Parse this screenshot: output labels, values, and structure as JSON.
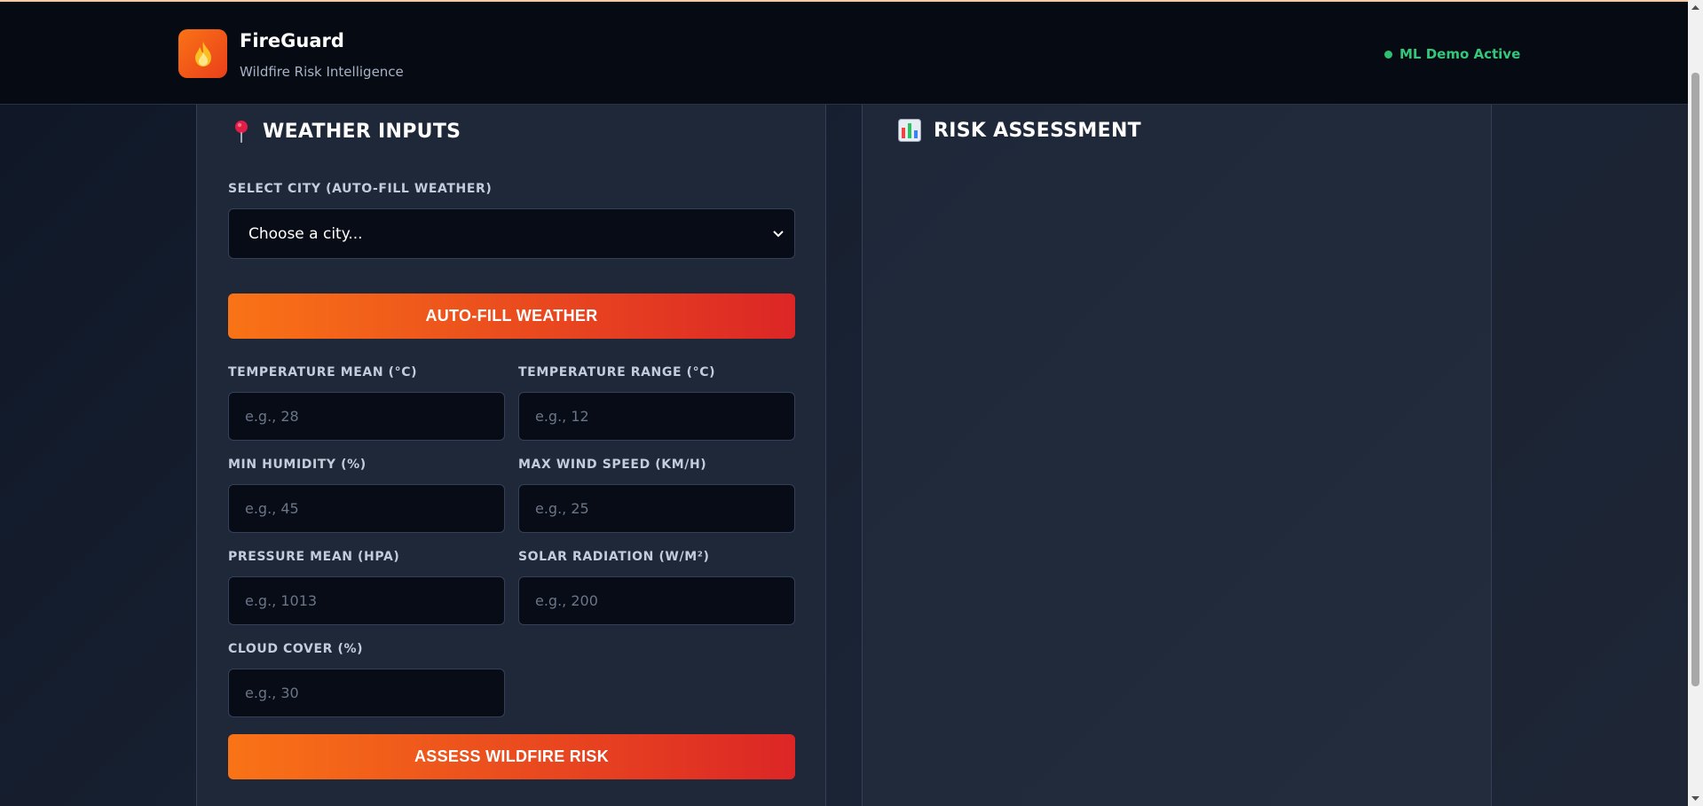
{
  "app": {
    "name": "FireGuard",
    "tagline": "Wildfire Risk Intelligence",
    "status": "ML Demo Active"
  },
  "icons": {
    "logo": "flame-icon",
    "weather_panel": "pushpin-icon",
    "risk_panel": "bar-chart-icon",
    "select": "chevron-down-icon"
  },
  "colors": {
    "accent_start": "#f97316",
    "accent_end": "#dc2626",
    "status": "#34c77b"
  },
  "weather_panel": {
    "title": "WEATHER INPUTS",
    "city_label": "SELECT CITY (AUTO-FILL WEATHER)",
    "city_selected": "Choose a city...",
    "autofill_button": "AUTO-FILL WEATHER",
    "fields": [
      {
        "label": "TEMPERATURE MEAN (°C)",
        "placeholder": "e.g., 28"
      },
      {
        "label": "TEMPERATURE RANGE (°C)",
        "placeholder": "e.g., 12"
      },
      {
        "label": "MIN HUMIDITY (%)",
        "placeholder": "e.g., 45"
      },
      {
        "label": "MAX WIND SPEED (KM/H)",
        "placeholder": "e.g., 25"
      },
      {
        "label": "PRESSURE MEAN (HPA)",
        "placeholder": "e.g., 1013"
      },
      {
        "label": "SOLAR RADIATION (W/M²)",
        "placeholder": "e.g., 200"
      },
      {
        "label": "CLOUD COVER (%)",
        "placeholder": "e.g., 30"
      }
    ],
    "assess_button": "ASSESS WILDFIRE RISK"
  },
  "risk_panel": {
    "title": "RISK ASSESSMENT"
  }
}
